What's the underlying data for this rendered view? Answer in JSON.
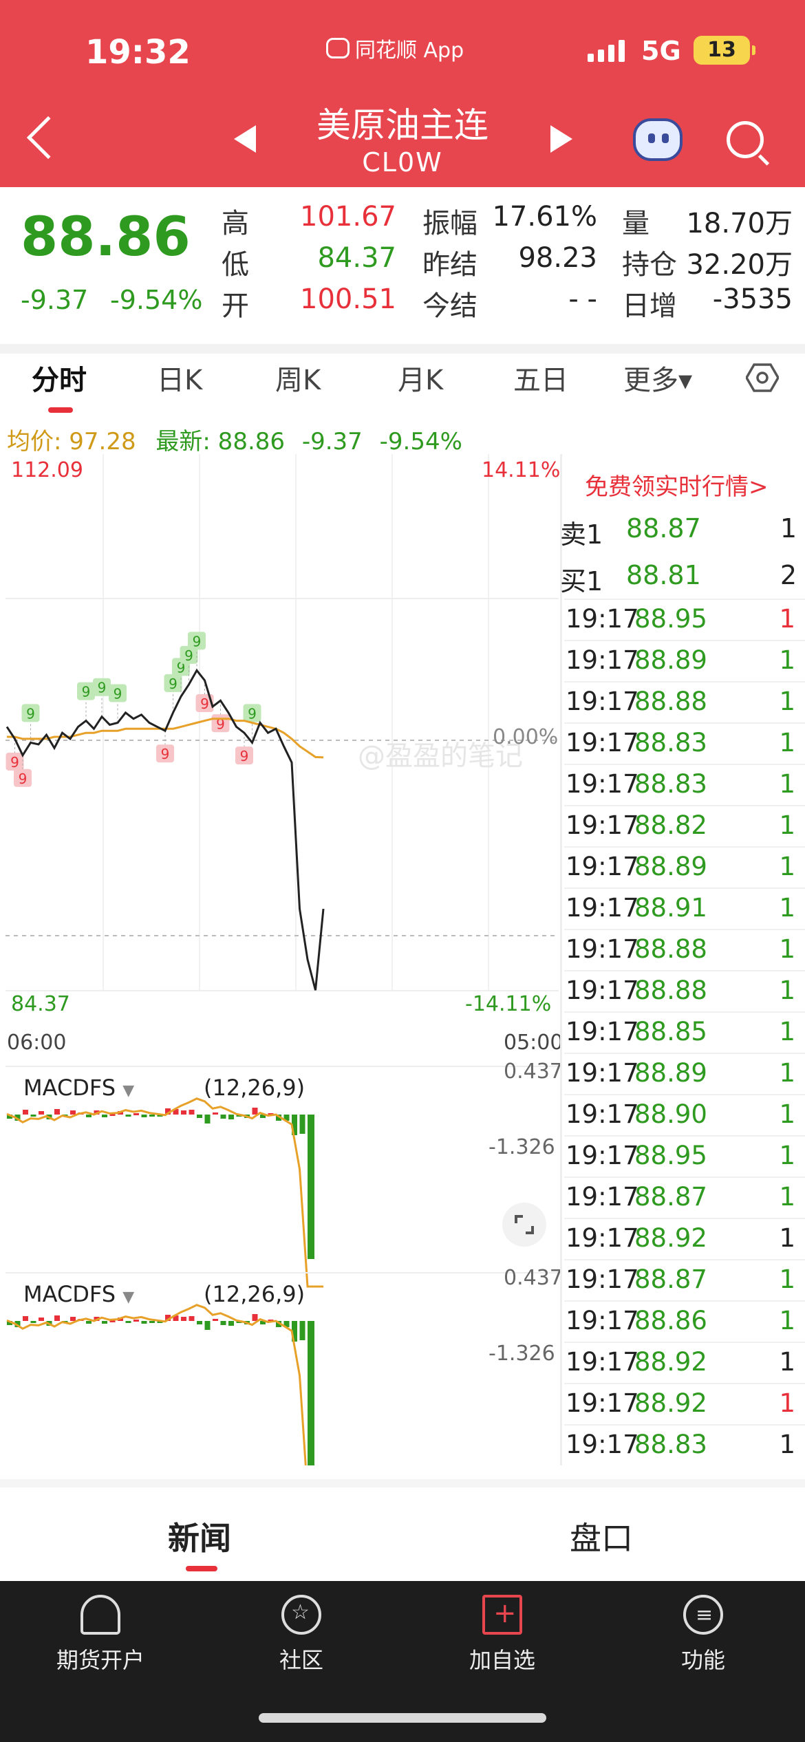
{
  "status": {
    "time": "19:32",
    "app_badge": "同花顺 App",
    "network": "5G",
    "battery": "13"
  },
  "header": {
    "title": "美原油主连",
    "subtitle": "CL0W"
  },
  "quote": {
    "price": "88.86",
    "change": "-9.37",
    "change_pct": "-9.54%",
    "stats": [
      {
        "label": "高",
        "value": "101.67",
        "tone": "red"
      },
      {
        "label": "低",
        "value": "84.37",
        "tone": "green"
      },
      {
        "label": "开",
        "value": "100.51",
        "tone": "red"
      },
      {
        "label": "振幅",
        "value": "17.61%",
        "tone": "dark"
      },
      {
        "label": "昨结",
        "value": "98.23",
        "tone": "dark"
      },
      {
        "label": "今结",
        "value": "- -",
        "tone": "dark"
      },
      {
        "label": "量",
        "value": "18.70万",
        "tone": "dark"
      },
      {
        "label": "持仓",
        "value": "32.20万",
        "tone": "dark"
      },
      {
        "label": "日增",
        "value": "-3535",
        "tone": "dark"
      }
    ]
  },
  "tabs": [
    "分时",
    "日K",
    "周K",
    "月K",
    "五日",
    "更多▾"
  ],
  "info_row": {
    "avg_label": "均价: 97.28",
    "latest_label": "最新: 88.86",
    "change": "-9.37",
    "change_pct": "-9.54%"
  },
  "chart_labels": {
    "top_left": "112.09",
    "top_right": "14.11%",
    "zero_pct": "0.00%",
    "bottom_left": "84.37",
    "bottom_right": "-14.11%",
    "time_start": "06:00",
    "time_end": "05:00",
    "macd_top": "0.437",
    "macd_mid": "-1.326",
    "macd_label": "MACDFS",
    "macd_params": "(12,26,9)",
    "watermark": "@盈盈的笔记",
    "marker_text": "9"
  },
  "chart_data": {
    "type": "line",
    "title": "",
    "ylim": [
      84.37,
      112.09
    ],
    "xlim_labels": [
      "06:00",
      "05:00"
    ],
    "reference": 98.23,
    "series": [
      {
        "values": [
          98.9,
          98.3,
          97.4,
          98.1,
          98.0,
          98.5,
          97.8,
          98.6,
          98.3,
          98.9,
          99.2,
          98.8,
          99.4,
          99.0,
          99.1,
          99.6,
          99.3,
          99.5,
          99.1,
          98.9,
          98.7,
          99.6,
          100.4,
          101.0,
          101.7,
          101.2,
          99.9,
          100.2,
          99.6,
          98.9,
          98.6,
          98.1,
          99.1,
          98.6,
          98.8,
          97.9,
          97.0,
          88.9,
          86.1,
          84.4,
          88.9
        ]
      },
      {
        "values": [
          98.4,
          98.4,
          98.3,
          98.3,
          98.3,
          98.3,
          98.4,
          98.4,
          98.4,
          98.5,
          98.6,
          98.6,
          98.7,
          98.7,
          98.7,
          98.8,
          98.8,
          98.8,
          98.8,
          98.8,
          98.8,
          98.8,
          98.9,
          99.0,
          99.1,
          99.2,
          99.3,
          99.3,
          99.3,
          99.2,
          99.2,
          99.1,
          99.0,
          98.9,
          98.8,
          98.6,
          98.3,
          97.9,
          97.6,
          97.3,
          97.28
        ]
      }
    ]
  },
  "order_book": {
    "free_quote": "免费领实时行情>",
    "ask": {
      "label": "卖1",
      "price": "88.87",
      "vol": "1"
    },
    "bid": {
      "label": "买1",
      "price": "88.81",
      "vol": "2"
    }
  },
  "ticks": [
    {
      "time": "19:17",
      "price": "88.95",
      "vol": "1",
      "tone": "red"
    },
    {
      "time": "19:17",
      "price": "88.89",
      "vol": "1",
      "tone": "green"
    },
    {
      "time": "19:17",
      "price": "88.88",
      "vol": "1",
      "tone": "green"
    },
    {
      "time": "19:17",
      "price": "88.83",
      "vol": "1",
      "tone": "green"
    },
    {
      "time": "19:17",
      "price": "88.83",
      "vol": "1",
      "tone": "green"
    },
    {
      "time": "19:17",
      "price": "88.82",
      "vol": "1",
      "tone": "green"
    },
    {
      "time": "19:17",
      "price": "88.89",
      "vol": "1",
      "tone": "green"
    },
    {
      "time": "19:17",
      "price": "88.91",
      "vol": "1",
      "tone": "green"
    },
    {
      "time": "19:17",
      "price": "88.88",
      "vol": "1",
      "tone": "green"
    },
    {
      "time": "19:17",
      "price": "88.88",
      "vol": "1",
      "tone": "green"
    },
    {
      "time": "19:17",
      "price": "88.85",
      "vol": "1",
      "tone": "green"
    },
    {
      "time": "19:17",
      "price": "88.89",
      "vol": "1",
      "tone": "green"
    },
    {
      "time": "19:17",
      "price": "88.90",
      "vol": "1",
      "tone": "green"
    },
    {
      "time": "19:17",
      "price": "88.95",
      "vol": "1",
      "tone": "green"
    },
    {
      "time": "19:17",
      "price": "88.87",
      "vol": "1",
      "tone": "green"
    },
    {
      "time": "19:17",
      "price": "88.92",
      "vol": "1",
      "tone": "dark"
    },
    {
      "time": "19:17",
      "price": "88.87",
      "vol": "1",
      "tone": "green"
    },
    {
      "time": "19:17",
      "price": "88.86",
      "vol": "1",
      "tone": "green"
    },
    {
      "time": "19:17",
      "price": "88.92",
      "vol": "1",
      "tone": "dark"
    },
    {
      "time": "19:17",
      "price": "88.92",
      "vol": "1",
      "tone": "red"
    },
    {
      "time": "19:17",
      "price": "88.83",
      "vol": "1",
      "tone": "dark"
    }
  ],
  "subtabs": [
    "新闻",
    "盘口"
  ],
  "nav": [
    "期货开户",
    "社区",
    "加自选",
    "功能"
  ],
  "colors": {
    "header": "#e8464f",
    "up": "#e8303a",
    "down": "#2e9a1f",
    "avg": "#d09a19"
  }
}
